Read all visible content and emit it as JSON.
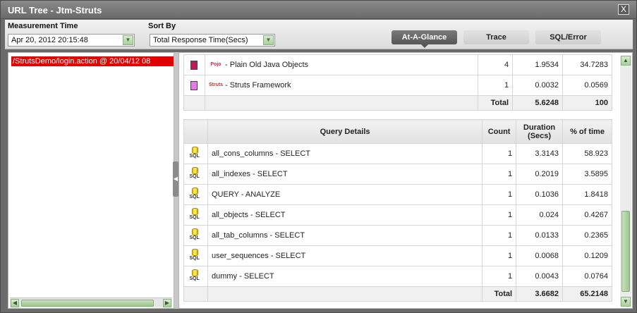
{
  "window": {
    "title": "URL Tree - Jtm-Struts",
    "close_label": "X"
  },
  "toolbar": {
    "measurement_label": "Measurement Time",
    "measurement_value": "Apr 20, 2012 20:15:48",
    "sortby_label": "Sort By",
    "sortby_value": "Total Response Time(Secs)",
    "tabs": [
      "At-A-Glance",
      "Trace",
      "SQL/Error"
    ],
    "active_tab": "At-A-Glance"
  },
  "tree": {
    "selected_item": "/StrutsDemo/login.action @ 20/04/12 08"
  },
  "frameworks": {
    "rows": [
      {
        "color": "#c2185b",
        "icon": "pojo-icon",
        "icon_text": "Pojo",
        "name": "- Plain Old Java Objects",
        "count": "4",
        "duration": "1.9534",
        "percent": "34.7283"
      },
      {
        "color": "#e879e8",
        "icon": "struts-icon",
        "icon_text": "Struts",
        "name": "- Struts Framework",
        "count": "1",
        "duration": "0.0032",
        "percent": "0.0569"
      }
    ],
    "total": {
      "label": "Total",
      "duration": "5.6248",
      "percent": "100"
    }
  },
  "queries": {
    "headers": {
      "details": "Query Details",
      "count": "Count",
      "duration": "Duration (Secs)",
      "percent": "% of time"
    },
    "icon_label": "SQL",
    "rows": [
      {
        "name": "all_cons_columns - SELECT",
        "count": "1",
        "duration": "3.3143",
        "percent": "58.923"
      },
      {
        "name": "all_indexes - SELECT",
        "count": "1",
        "duration": "0.2019",
        "percent": "3.5895"
      },
      {
        "name": "QUERY - ANALYZE",
        "count": "1",
        "duration": "0.1036",
        "percent": "1.8418"
      },
      {
        "name": "all_objects - SELECT",
        "count": "1",
        "duration": "0.024",
        "percent": "0.4267"
      },
      {
        "name": "all_tab_columns - SELECT",
        "count": "1",
        "duration": "0.0133",
        "percent": "0.2365"
      },
      {
        "name": "user_sequences - SELECT",
        "count": "1",
        "duration": "0.0068",
        "percent": "0.1209"
      },
      {
        "name": "dummy - SELECT",
        "count": "1",
        "duration": "0.0043",
        "percent": "0.0764"
      }
    ],
    "total": {
      "label": "Total",
      "duration": "3.6682",
      "percent": "65.2148"
    }
  }
}
